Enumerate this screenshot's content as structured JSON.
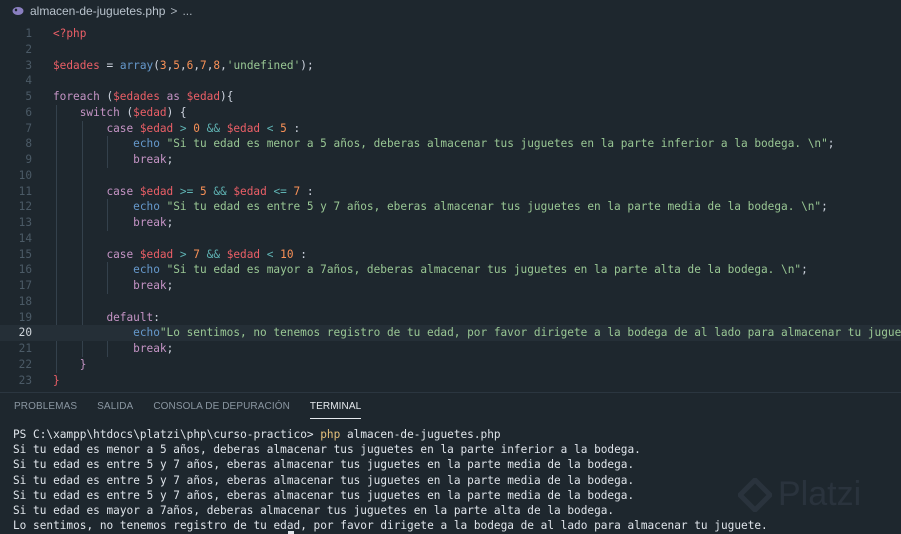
{
  "breadcrumb": {
    "file": "almacen-de-juguetes.php",
    "separator": ">",
    "more": "..."
  },
  "editor": {
    "current_line": 20,
    "lines": [
      {
        "n": "1",
        "t": [
          [
            "tag",
            "<?php"
          ]
        ]
      },
      {
        "n": "2",
        "t": []
      },
      {
        "n": "3",
        "t": [
          [
            "var",
            "$edades"
          ],
          [
            "plain",
            " = "
          ],
          [
            "fn",
            "array"
          ],
          [
            "plain",
            "("
          ],
          [
            "num",
            "3"
          ],
          [
            "plain",
            ","
          ],
          [
            "num",
            "5"
          ],
          [
            "plain",
            ","
          ],
          [
            "num",
            "6"
          ],
          [
            "plain",
            ","
          ],
          [
            "num",
            "7"
          ],
          [
            "plain",
            ","
          ],
          [
            "num",
            "8"
          ],
          [
            "plain",
            ","
          ],
          [
            "str",
            "'undefined'"
          ],
          [
            "plain",
            ");"
          ]
        ]
      },
      {
        "n": "4",
        "t": []
      },
      {
        "n": "5",
        "t": [
          [
            "kw",
            "foreach"
          ],
          [
            "plain",
            " ("
          ],
          [
            "var",
            "$edades"
          ],
          [
            "kw",
            " as "
          ],
          [
            "var",
            "$edad"
          ],
          [
            "plain",
            "){"
          ]
        ]
      },
      {
        "n": "6",
        "t": [
          [
            "plain",
            "    "
          ],
          [
            "kw",
            "switch"
          ],
          [
            "plain",
            " ("
          ],
          [
            "var",
            "$edad"
          ],
          [
            "plain",
            ") {"
          ]
        ]
      },
      {
        "n": "7",
        "t": [
          [
            "plain",
            "        "
          ],
          [
            "kw",
            "case"
          ],
          [
            "plain",
            " "
          ],
          [
            "var",
            "$edad"
          ],
          [
            "punc",
            " > "
          ],
          [
            "num",
            "0"
          ],
          [
            "punc",
            " && "
          ],
          [
            "var",
            "$edad"
          ],
          [
            "punc",
            " < "
          ],
          [
            "num",
            "5"
          ],
          [
            "plain",
            " :"
          ]
        ]
      },
      {
        "n": "8",
        "t": [
          [
            "plain",
            "            "
          ],
          [
            "fn",
            "echo"
          ],
          [
            "plain",
            " "
          ],
          [
            "str",
            "\"Si tu edad es menor a 5 años, deberas almacenar tus juguetes en la parte inferior a la bodega. \\n\""
          ],
          [
            "plain",
            ";"
          ]
        ]
      },
      {
        "n": "9",
        "t": [
          [
            "plain",
            "            "
          ],
          [
            "kw",
            "break"
          ],
          [
            "plain",
            ";"
          ]
        ]
      },
      {
        "n": "10",
        "t": []
      },
      {
        "n": "11",
        "t": [
          [
            "plain",
            "        "
          ],
          [
            "kw",
            "case"
          ],
          [
            "plain",
            " "
          ],
          [
            "var",
            "$edad"
          ],
          [
            "punc",
            " >= "
          ],
          [
            "num",
            "5"
          ],
          [
            "punc",
            " && "
          ],
          [
            "var",
            "$edad"
          ],
          [
            "punc",
            " <= "
          ],
          [
            "num",
            "7"
          ],
          [
            "plain",
            " :"
          ]
        ]
      },
      {
        "n": "12",
        "t": [
          [
            "plain",
            "            "
          ],
          [
            "fn",
            "echo"
          ],
          [
            "plain",
            " "
          ],
          [
            "str",
            "\"Si tu edad es entre 5 y 7 años, eberas almacenar tus juguetes en la parte media de la bodega. \\n\""
          ],
          [
            "plain",
            ";"
          ]
        ]
      },
      {
        "n": "13",
        "t": [
          [
            "plain",
            "            "
          ],
          [
            "kw",
            "break"
          ],
          [
            "plain",
            ";"
          ]
        ]
      },
      {
        "n": "14",
        "t": []
      },
      {
        "n": "15",
        "t": [
          [
            "plain",
            "        "
          ],
          [
            "kw",
            "case"
          ],
          [
            "plain",
            " "
          ],
          [
            "var",
            "$edad"
          ],
          [
            "punc",
            " > "
          ],
          [
            "num",
            "7"
          ],
          [
            "punc",
            " && "
          ],
          [
            "var",
            "$edad"
          ],
          [
            "punc",
            " < "
          ],
          [
            "num",
            "10"
          ],
          [
            "plain",
            " :"
          ]
        ]
      },
      {
        "n": "16",
        "t": [
          [
            "plain",
            "            "
          ],
          [
            "fn",
            "echo"
          ],
          [
            "plain",
            " "
          ],
          [
            "str",
            "\"Si tu edad es mayor a 7años, deberas almacenar tus juguetes en la parte alta de la bodega. \\n\""
          ],
          [
            "plain",
            ";"
          ]
        ]
      },
      {
        "n": "17",
        "t": [
          [
            "plain",
            "            "
          ],
          [
            "kw",
            "break"
          ],
          [
            "plain",
            ";"
          ]
        ]
      },
      {
        "n": "18",
        "t": []
      },
      {
        "n": "19",
        "t": [
          [
            "plain",
            "        "
          ],
          [
            "kw",
            "default"
          ],
          [
            "plain",
            ":"
          ]
        ]
      },
      {
        "n": "20",
        "t": [
          [
            "plain",
            "            "
          ],
          [
            "fn",
            "echo"
          ],
          [
            "str",
            "\"Lo sentimos, no tenemos registro de tu edad, por favor dirigete a la bodega de al lado para almacenar tu juguete.\""
          ],
          [
            "plain",
            ";"
          ]
        ]
      },
      {
        "n": "21",
        "t": [
          [
            "plain",
            "            "
          ],
          [
            "kw",
            "break"
          ],
          [
            "plain",
            ";"
          ]
        ]
      },
      {
        "n": "22",
        "t": [
          [
            "plain",
            "    "
          ],
          [
            "kw",
            "}"
          ]
        ]
      },
      {
        "n": "23",
        "t": [
          [
            "tag",
            "}"
          ]
        ]
      },
      {
        "n": "24",
        "t": []
      }
    ]
  },
  "panel": {
    "tabs": [
      "PROBLEMAS",
      "SALIDA",
      "CONSOLA DE DEPURACIÓN",
      "TERMINAL"
    ],
    "active_tab": "TERMINAL",
    "terminal": {
      "prompt": "PS C:\\xampp\\htdocs\\platzi\\php\\curso-practico> ",
      "command_name": "php",
      "command_args": " almacen-de-juguetes.php",
      "output": [
        "Si tu edad es menor a 5 años, deberas almacenar tus juguetes en la parte inferior a la bodega.",
        "Si tu edad es entre 5 y 7 años, eberas almacenar tus juguetes en la parte media de la bodega.",
        "Si tu edad es entre 5 y 7 años, eberas almacenar tus juguetes en la parte media de la bodega.",
        "Si tu edad es entre 5 y 7 años, eberas almacenar tus juguetes en la parte media de la bodega.",
        "Si tu edad es mayor a 7años, deberas almacenar tus juguetes en la parte alta de la bodega.",
        "Lo sentimos, no tenemos registro de tu edad, por favor dirigete a la bodega de al lado para almacenar tu juguete."
      ]
    }
  },
  "watermark": {
    "text": "Platzi"
  },
  "icons": {
    "file_icon": "php-elephant-icon",
    "watermark_icon": "platzi-logo-icon"
  },
  "colors": {
    "keyword": "#c594c5",
    "variable": "#ec5f67",
    "function": "#6699cc",
    "number": "#f99157",
    "string": "#99c794",
    "operator": "#5fb3b3",
    "background": "#1e272e"
  }
}
